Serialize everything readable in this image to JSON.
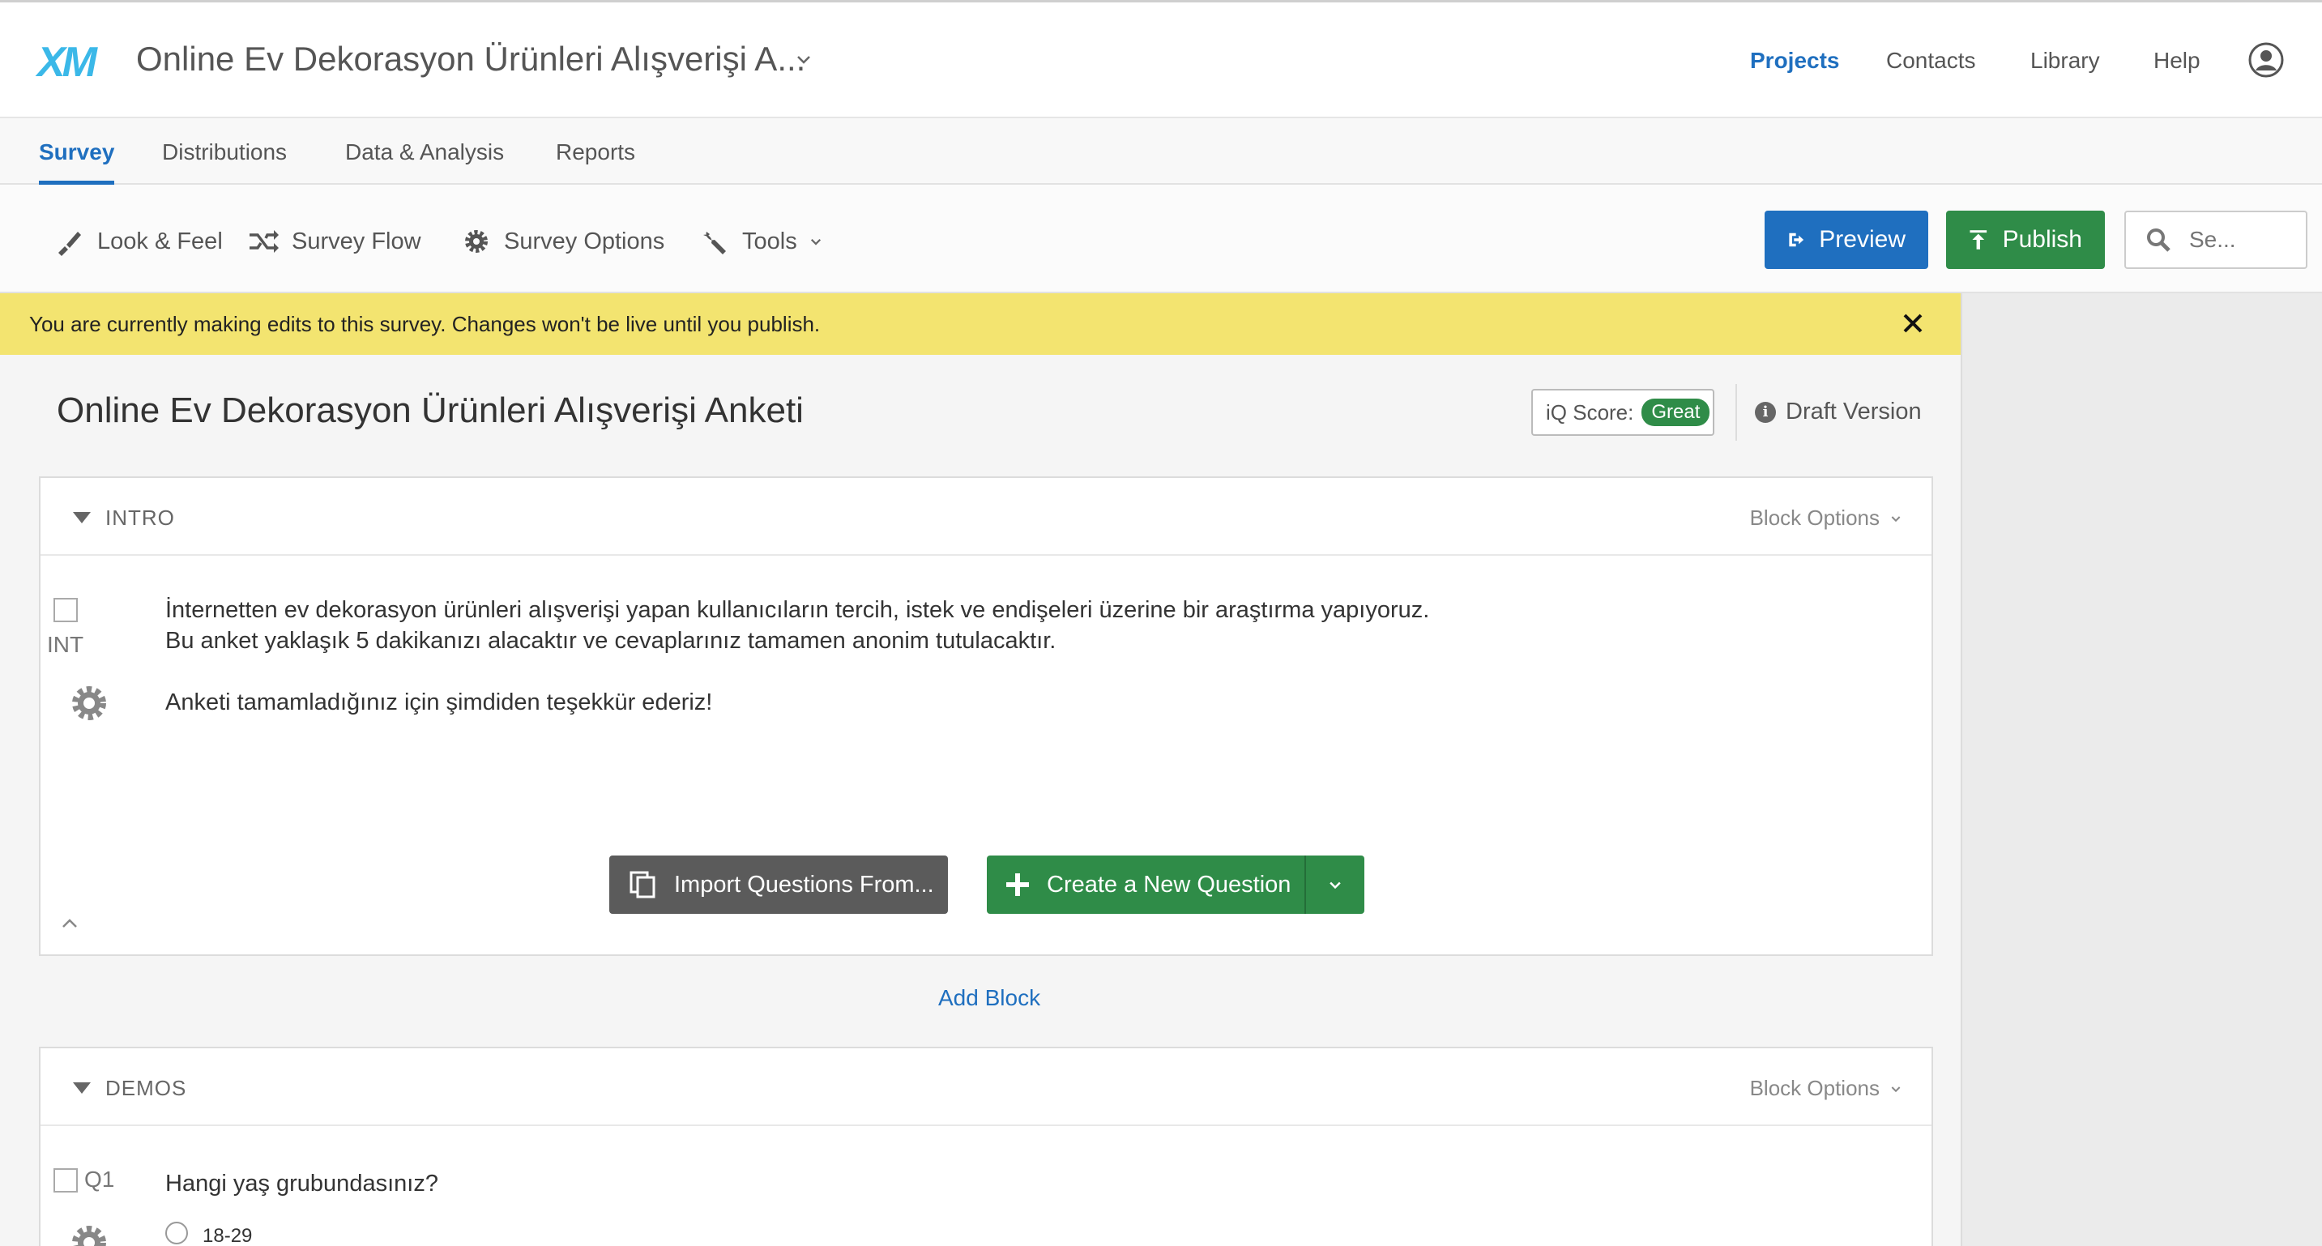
{
  "header": {
    "logo": "XM",
    "project_title": "Online Ev Dekorasyon Ürünleri Alışverişi A...",
    "nav": [
      "Projects",
      "Contacts",
      "Library",
      "Help"
    ],
    "active_nav": "Projects"
  },
  "tabs": [
    "Survey",
    "Distributions",
    "Data & Analysis",
    "Reports"
  ],
  "toolbar": {
    "look_feel": "Look & Feel",
    "survey_flow": "Survey Flow",
    "survey_options": "Survey Options",
    "tools": "Tools",
    "preview": "Preview",
    "publish": "Publish",
    "search_placeholder": "Se..."
  },
  "banner": {
    "message": "You are currently making edits to this survey. Changes won't be live until you publish."
  },
  "survey": {
    "title": "Online Ev Dekorasyon Ürünleri Alışverişi Anketi",
    "iq_label": "iQ Score:",
    "iq_value": "Great",
    "version": "Draft Version"
  },
  "blocks": [
    {
      "name": "INTRO",
      "options_label": "Block Options",
      "question": {
        "id": "INT",
        "line1": "İnternetten ev dekorasyon ürünleri alışverişi yapan kullanıcıların tercih, istek ve endişeleri üzerine bir araştırma yapıyoruz.",
        "line2": "Bu anket yaklaşık 5 dakikanızı alacaktır ve cevaplarınız tamamen anonim tutulacaktır.",
        "line3": "Anketi tamamladığınız için şimdiden teşekkür ederiz!"
      },
      "import_label": "Import Questions From...",
      "create_label": "Create a New Question"
    },
    {
      "name": "DEMOS",
      "options_label": "Block Options",
      "question": {
        "id": "Q1",
        "text": "Hangi yaş grubundasınız?",
        "first_option": "18-29"
      }
    }
  ],
  "add_block": "Add Block",
  "colors": {
    "primary": "#1f6fbf",
    "publish": "#2f8c48",
    "banner": "#f3e470"
  }
}
